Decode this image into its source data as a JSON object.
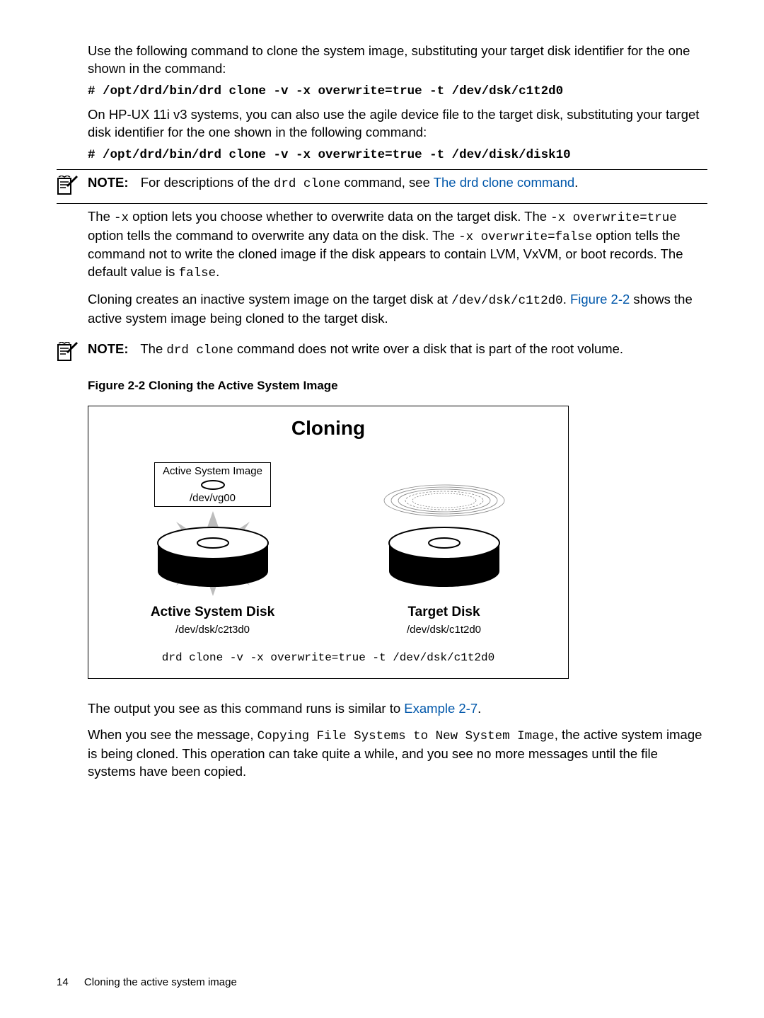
{
  "intro": {
    "p1": "Use the following command to clone the system image, substituting your target disk identifier for the one shown in the command:",
    "cmd1": "# /opt/drd/bin/drd clone -v -x overwrite=true -t /dev/dsk/c1t2d0",
    "p2": "On HP-UX 11i v3 systems, you can also use the agile device file to the target disk, substituting your target disk identifier for the one shown in the following command:",
    "cmd2": "# /opt/drd/bin/drd clone -v -x overwrite=true -t /dev/disk/disk10"
  },
  "note1": {
    "label": "NOTE:",
    "lead": "For descriptions of the ",
    "code1": "drd clone",
    "mid": " command, see ",
    "link": "The drd clone command",
    "tail": "."
  },
  "body": {
    "p3a": "The ",
    "p3b": "-x",
    "p3c": " option lets you choose whether to overwrite data on the target disk. The ",
    "p3d": "-x overwrite=true",
    "p3e": " option tells the command to overwrite any data on the disk. The ",
    "p3f": "-x overwrite=false",
    "p3g": " option tells the command not to write the cloned image if the disk appears to contain LVM, VxVM, or boot records. The default value is ",
    "p3h": "false",
    "p3i": ".",
    "p4a": "Cloning creates an inactive system image on the target disk at ",
    "p4b": "/dev/dsk/c1t2d0",
    "p4c": ". ",
    "p4link": "Figure 2-2",
    "p4d": " shows the active system image being cloned to the target disk."
  },
  "note2": {
    "label": "NOTE:",
    "lead": "The ",
    "code1": "drd clone",
    "tail": " command does not write over a disk that is part of the root volume."
  },
  "figure": {
    "caption": "Figure 2-2 Cloning the Active System Image",
    "title": "Cloning",
    "active_box_line1": "Active System Image",
    "active_box_line2": "/dev/vg00",
    "active_name": "Active System Disk",
    "active_path": "/dev/dsk/c2t3d0",
    "target_name": "Target Disk",
    "target_path": "/dev/dsk/c1t2d0",
    "cmd": "drd clone -v -x overwrite=true -t /dev/dsk/c1t2d0"
  },
  "outro": {
    "p5a": "The output you see as this command runs is similar to ",
    "p5link": "Example 2-7",
    "p5b": ".",
    "p6a": "When you see the message, ",
    "p6b": "Copying File Systems to New System Image",
    "p6c": ", the active system image is being cloned. This operation can take quite a while, and you see no more messages until the file systems have been copied."
  },
  "footer": {
    "page": "14",
    "title": "Cloning the active system image"
  }
}
